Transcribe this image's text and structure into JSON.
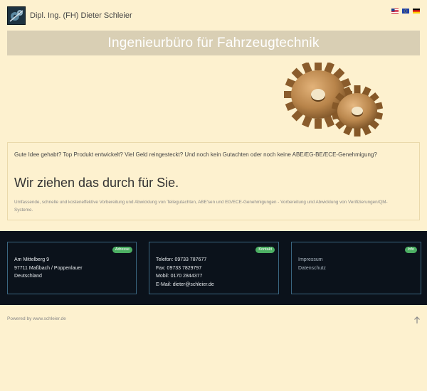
{
  "header": {
    "brand": "Dipl. Ing. (FH) Dieter Schleier",
    "logo_icon": "gear-logo-icon",
    "languages": [
      {
        "icon": "us-flag-icon"
      },
      {
        "icon": "eu-flag-icon"
      },
      {
        "icon": "de-flag-icon"
      }
    ]
  },
  "banner": {
    "title": "Ingenieurbüro für Fahrzeugtechnik"
  },
  "hero_image": {
    "icon": "gears-image",
    "color": "#b8844a"
  },
  "intro": {
    "question": "Gute Idee gehabt? Top Produkt entwickelt? Viel Geld reingesteckt? Und noch kein Gutachten oder noch keine ABE/EG-BE/ECE-Genehmigung?",
    "heading": "Wir ziehen das durch für Sie.",
    "body": "Umfassende, schnelle und kosteneffektive Vorbereitung und Abwicklung von Teilegutachten, ABE'sen und EG/ECE-Genehmigungen - Vorbereitung und Abwicklung von Verifizierungen/QM-Systeme."
  },
  "footer": {
    "address": {
      "badge": "Adresse",
      "lines": [
        "Am Mittelberg 9",
        "97711 Maßbach / Poppenlauer",
        "Deutschland"
      ]
    },
    "contact": {
      "badge": "Kontakt",
      "lines": [
        "Telefon: 09733 787677",
        "Fax: 09733 7829797",
        "Mobil: 0170 2844377",
        "E-Mail: dieter@schleier.de"
      ]
    },
    "info": {
      "badge": "Info",
      "links": [
        "Impressum",
        "Datenschutz"
      ]
    },
    "badge_color": "#4caf63",
    "background": "#0b121b"
  },
  "bottom": {
    "powered_by": "Powered by www.schleier.de",
    "scroll_top_icon": "arrow-up-icon"
  },
  "colors": {
    "page_background": "#fdf1cf",
    "banner_background": "#d9cfb4"
  }
}
